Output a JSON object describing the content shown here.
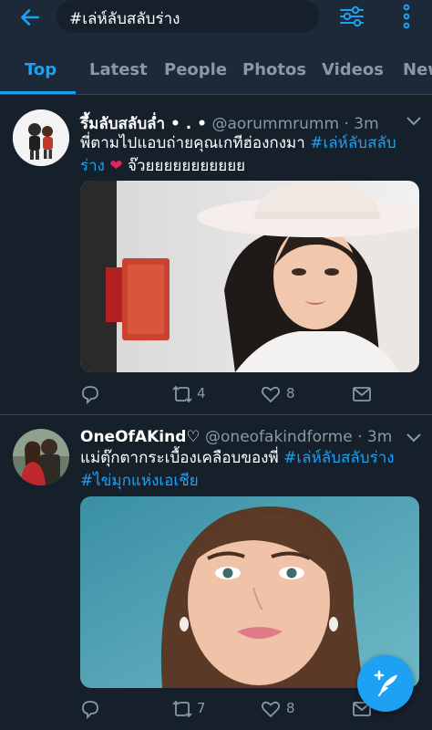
{
  "search": {
    "query": "#เล่ห์ลับสลับร่าง"
  },
  "tabs": [
    {
      "label": "Top"
    },
    {
      "label": "Latest"
    },
    {
      "label": "People"
    },
    {
      "label": "Photos"
    },
    {
      "label": "Videos"
    },
    {
      "label": "New"
    }
  ],
  "tweets": [
    {
      "name": "รึ้มลับสลับล่ำ • . •",
      "handle": "@aorummrumm",
      "time": "3m",
      "text": "พี่ตามไปแอบถ่ายคุณเกทีฮ่องกงมา",
      "hashtag1": "#เล่ห์ลับสลับ",
      "hashtag2": "ร่าง",
      "tail": "จ๊วยยยยยยยยยยย",
      "retweets": "4",
      "likes": "8"
    },
    {
      "name": "OneOfAKind♡",
      "handle": "@oneofakindforme",
      "time": "3m",
      "text": "แม่ตุ๊กตากระเบื้องเคลือบของพี่",
      "hashtag1": "#เล่ห์ลับสลับร่าง",
      "hashtag2": "#ไข่มุกแห่งเอเชีย",
      "retweets": "7",
      "likes": "8"
    }
  ],
  "icons": {
    "back": "back-arrow-icon",
    "filter": "filter-sliders-icon",
    "more": "more-vertical-icon",
    "reply": "reply-icon",
    "retweet": "retweet-icon",
    "like": "heart-icon",
    "dm": "envelope-icon",
    "compose": "compose-tweet-icon"
  },
  "colors": {
    "accent": "#1da1f2",
    "background": "#15202b",
    "bar": "#1c2938",
    "muted": "#8899a6"
  }
}
